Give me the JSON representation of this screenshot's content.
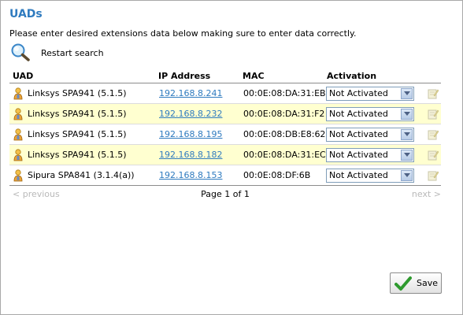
{
  "page": {
    "title": "UADs",
    "intro": "Please enter desired extensions data below making sure to enter data correctly.",
    "restart_label": "Restart search",
    "search_icon": "magnifier-icon"
  },
  "table": {
    "headers": {
      "uad": "UAD",
      "ip": "IP Address",
      "mac": "MAC",
      "activation": "Activation"
    },
    "rows": [
      {
        "uad": "Linksys SPA941 (5.1.5)",
        "ip": "192.168.8.241",
        "mac": "00:0E:08:DA:31:EB",
        "activation": "Not Activated",
        "highlight": false
      },
      {
        "uad": "Linksys SPA941 (5.1.5)",
        "ip": "192.168.8.232",
        "mac": "00:0E:08:DA:31:F2",
        "activation": "Not Activated",
        "highlight": true
      },
      {
        "uad": "Linksys SPA941 (5.1.5)",
        "ip": "192.168.8.195",
        "mac": "00:0E:08:DB:E8:62",
        "activation": "Not Activated",
        "highlight": false
      },
      {
        "uad": "Linksys SPA941 (5.1.5)",
        "ip": "192.168.8.182",
        "mac": "00:0E:08:DA:31:EC",
        "activation": "Not Activated",
        "highlight": true
      },
      {
        "uad": "Sipura SPA841 (3.1.4(a))",
        "ip": "192.168.8.153",
        "mac": "00:0E:08:DF:6B",
        "activation": "Not Activated",
        "highlight": false
      }
    ]
  },
  "pager": {
    "prev": "< previous",
    "next": "next >",
    "info": "Page 1 of 1"
  },
  "save_label": "Save",
  "colors": {
    "title": "#2f7bbf",
    "link": "#2f7bbf",
    "row_highlight": "#ffffd0",
    "disabled_text": "#b9b9b9",
    "save_check": "#2e9a2e"
  }
}
